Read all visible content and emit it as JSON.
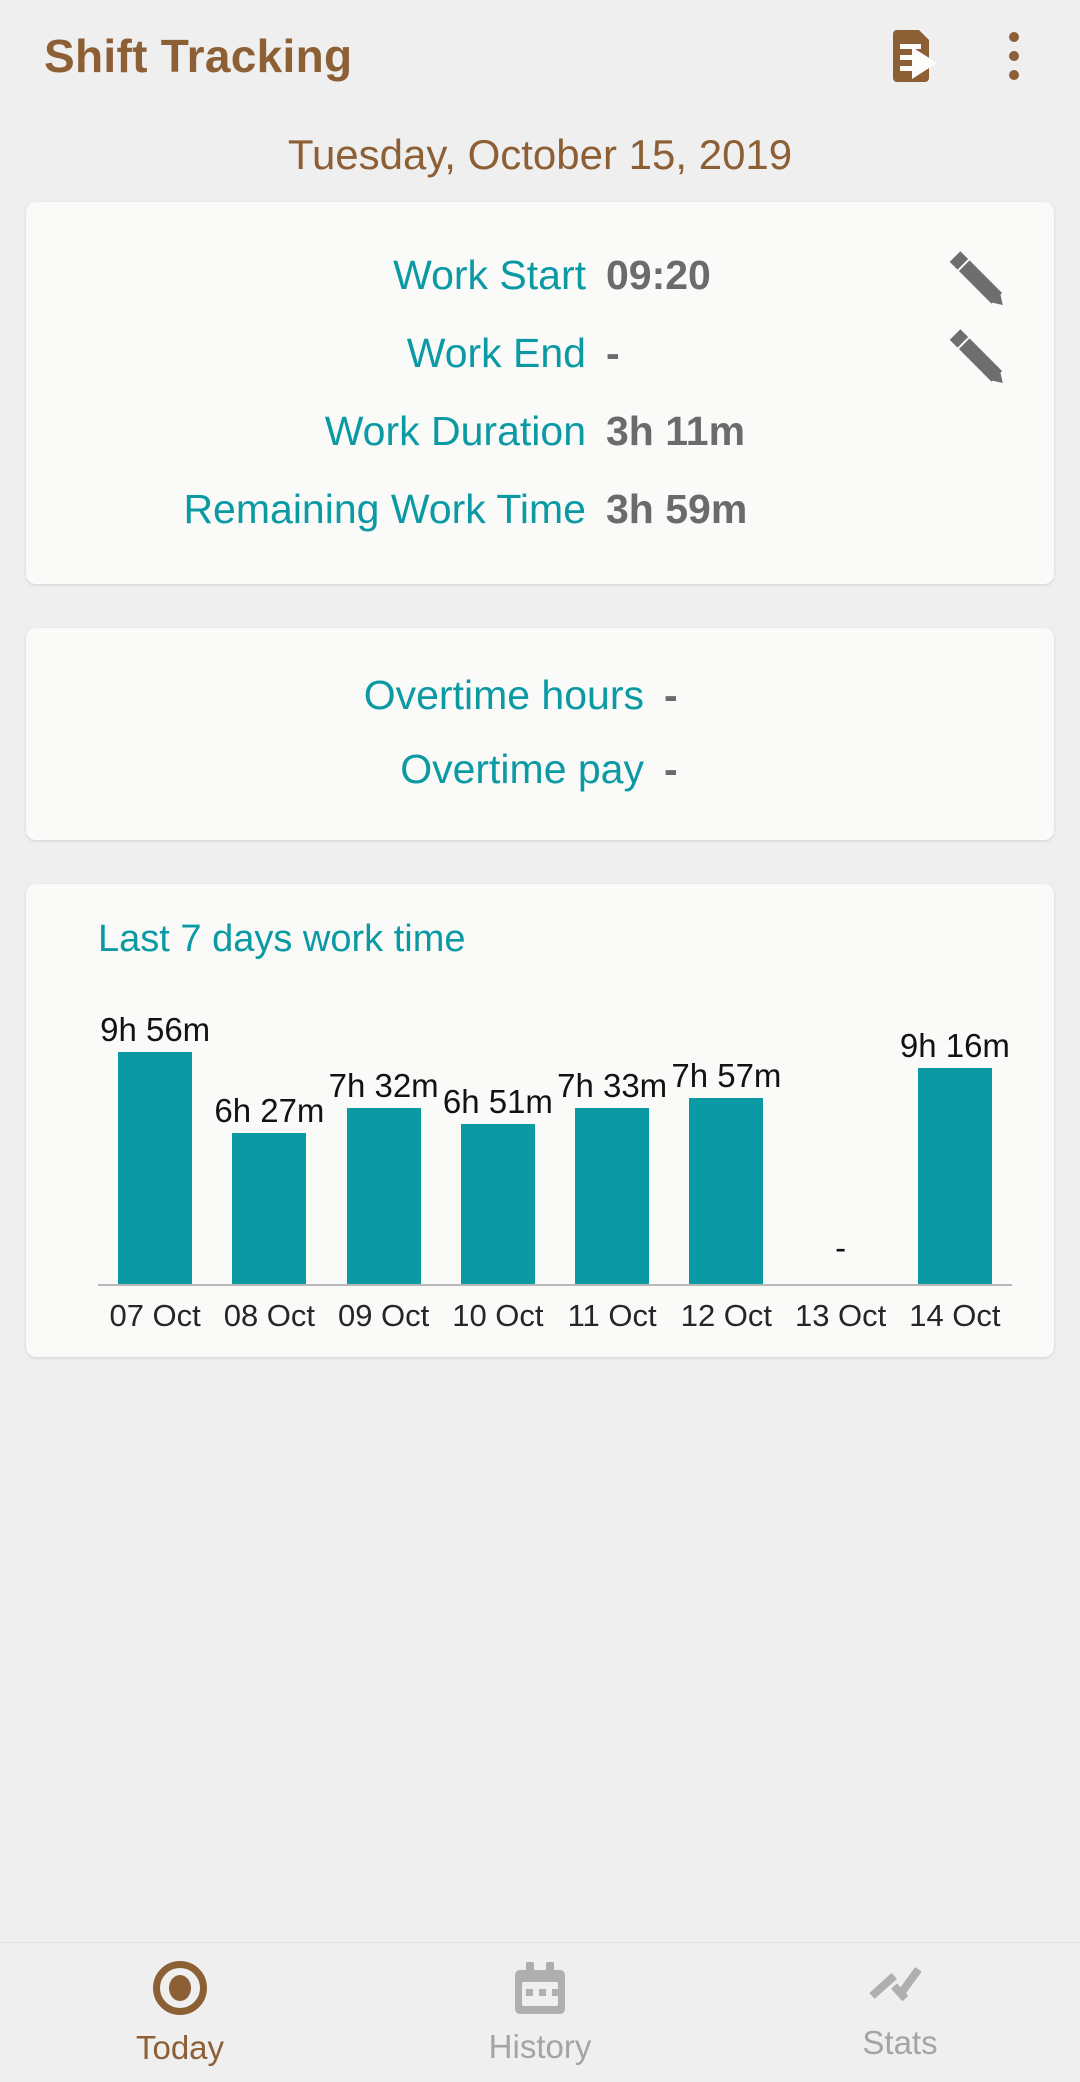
{
  "toolbar": {
    "title": "Shift Tracking",
    "export_icon": "document-export-icon",
    "overflow_icon": "overflow-menu-icon"
  },
  "date_header": "Tuesday, October 15, 2019",
  "shift_card": {
    "rows": [
      {
        "label": "Work Start",
        "value": "09:20",
        "editable": true
      },
      {
        "label": "Work End",
        "value": "-",
        "editable": true
      },
      {
        "label": "Work Duration",
        "value": "3h 11m",
        "editable": false
      },
      {
        "label": "Remaining Work Time",
        "value": "3h 59m",
        "editable": false
      }
    ]
  },
  "overtime_card": {
    "rows": [
      {
        "label": "Overtime hours",
        "value": "-"
      },
      {
        "label": "Overtime pay",
        "value": "-"
      }
    ]
  },
  "chart_card": {
    "title": "Last 7 days work time"
  },
  "chart_data": {
    "type": "bar",
    "title": "Last 7 days work time",
    "xlabel": "",
    "ylabel": "",
    "grid": false,
    "legend": "none",
    "categories": [
      "07 Oct",
      "08 Oct",
      "09 Oct",
      "10 Oct",
      "11 Oct",
      "12 Oct",
      "13 Oct",
      "14 Oct"
    ],
    "value_labels": [
      "9h 56m",
      "6h 27m",
      "7h 32m",
      "6h 51m",
      "7h 33m",
      "7h 57m",
      "-",
      "9h 16m"
    ],
    "values": [
      9.933,
      6.45,
      7.533,
      6.85,
      7.55,
      7.95,
      0,
      9.267
    ],
    "ylim": [
      0,
      9.933
    ],
    "bar_color": "#0b9aa4",
    "unit": "hours"
  },
  "bottom_nav": {
    "items": [
      {
        "label": "Today",
        "icon": "today-dot-icon",
        "active": true
      },
      {
        "label": "History",
        "icon": "calendar-icon",
        "active": false
      },
      {
        "label": "Stats",
        "icon": "trendline-icon",
        "active": false
      }
    ]
  },
  "colors": {
    "brand_brown": "#8d5f35",
    "accent_teal": "#0b9aa4",
    "value_gray": "#6b6b6b",
    "page_bg": "#f0eff0",
    "card_bg": "#fafaf8"
  }
}
